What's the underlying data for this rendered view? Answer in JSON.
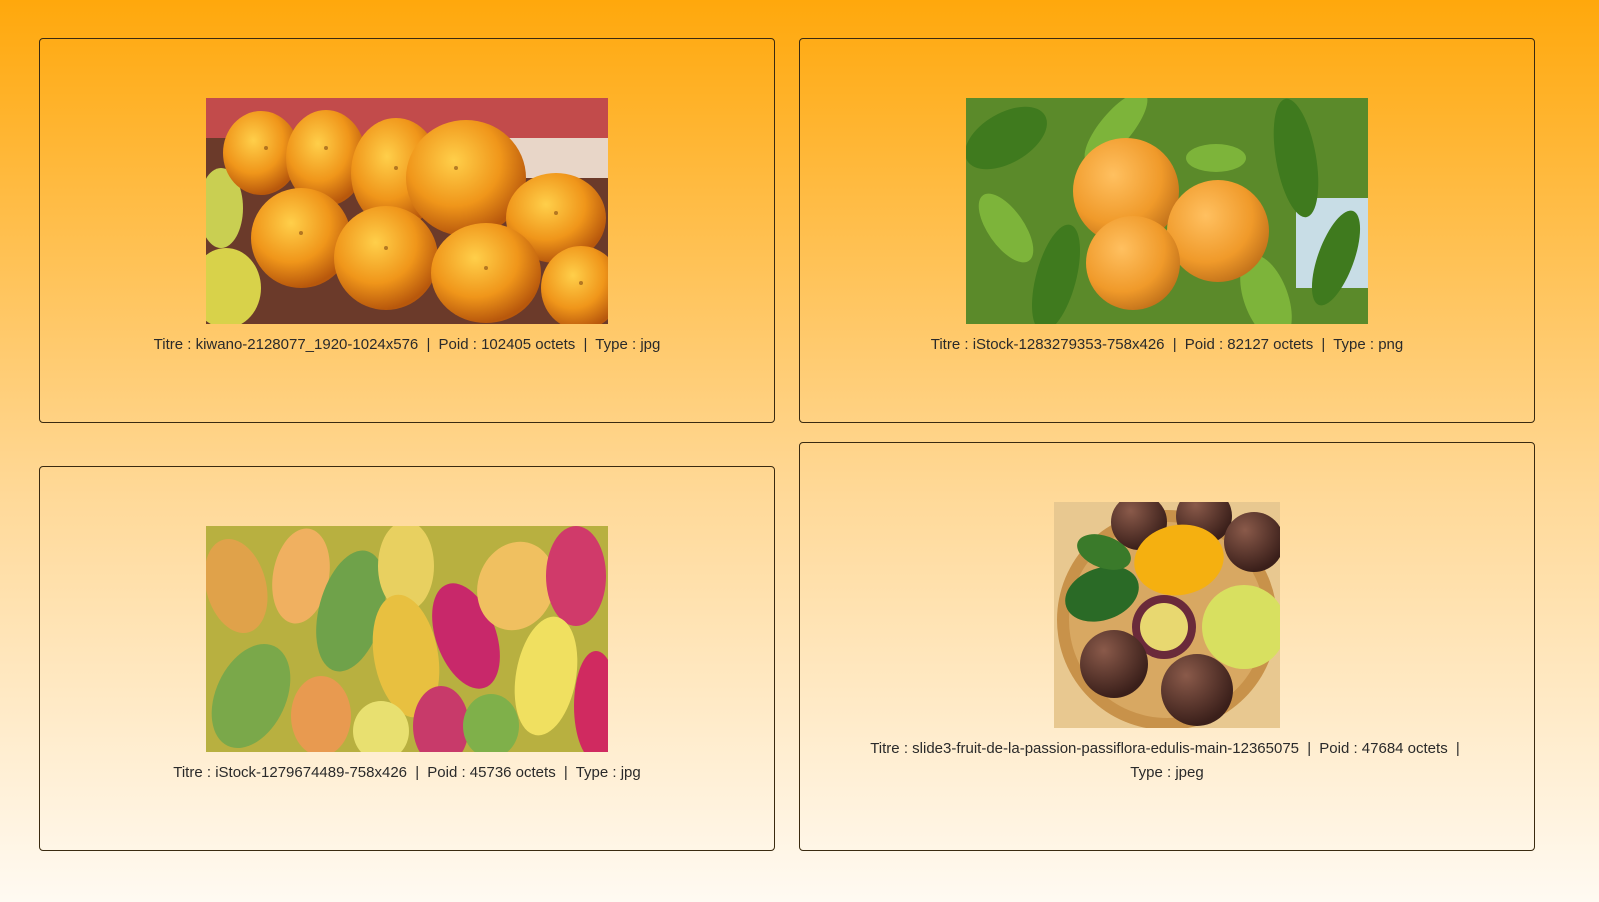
{
  "gallery": {
    "items": [
      {
        "title_label": "Titre :",
        "title": "kiwano-2128077_1920-1024x576",
        "weight_label": "Poid :",
        "weight": "102405 octets",
        "type_label": "Type :",
        "type": "jpg",
        "image": "kiwano-fruit-photo"
      },
      {
        "title_label": "Titre :",
        "title": "iStock-1283279353-758x426",
        "weight_label": "Poid :",
        "weight": "82127 octets",
        "type_label": "Type :",
        "type": "png",
        "image": "oranges-on-tree-photo"
      },
      {
        "title_label": "Titre :",
        "title": "iStock-1279674489-758x426",
        "weight_label": "Poid :",
        "weight": "45736 octets",
        "type_label": "Type :",
        "type": "jpg",
        "image": "prickly-pears-photo"
      },
      {
        "title_label": "Titre :",
        "title": "slide3-fruit-de-la-passion-passiflora-edulis-main-12365075",
        "weight_label": "Poid :",
        "weight": "47684 octets",
        "type_label": "Type :",
        "type": "jpeg",
        "image": "passion-fruit-basket-photo"
      }
    ],
    "separator": "|"
  }
}
